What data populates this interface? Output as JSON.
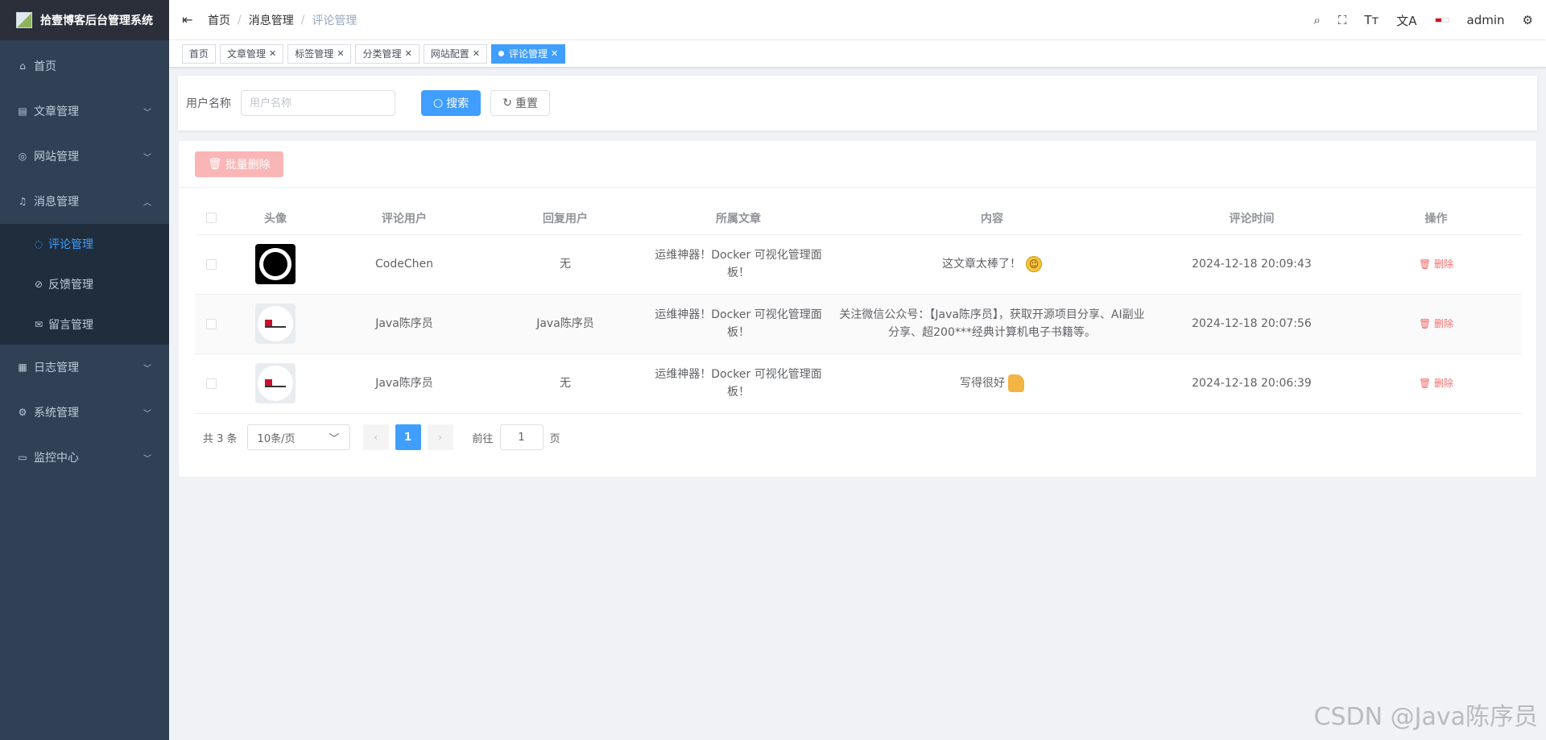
{
  "app": {
    "title": "拾壹博客后台管理系统"
  },
  "sidebar": {
    "items": [
      {
        "label": "首页",
        "icon": "home-icon"
      },
      {
        "label": "文章管理",
        "icon": "document-icon"
      },
      {
        "label": "网站管理",
        "icon": "website-icon"
      },
      {
        "label": "消息管理",
        "icon": "bell-icon"
      },
      {
        "label": "日志管理",
        "icon": "log-icon"
      },
      {
        "label": "系统管理",
        "icon": "gear-icon"
      },
      {
        "label": "监控中心",
        "icon": "monitor-icon"
      }
    ],
    "message_sub": [
      {
        "label": "评论管理",
        "active": true
      },
      {
        "label": "反馈管理"
      },
      {
        "label": "留言管理"
      }
    ]
  },
  "breadcrumb": [
    "首页",
    "消息管理",
    "评论管理"
  ],
  "header": {
    "user": "admin"
  },
  "tags": [
    {
      "label": "首页"
    },
    {
      "label": "文章管理"
    },
    {
      "label": "标签管理"
    },
    {
      "label": "分类管理"
    },
    {
      "label": "网站配置"
    },
    {
      "label": "评论管理",
      "active": true
    }
  ],
  "search": {
    "label": "用户名称",
    "placeholder": "用户名称",
    "search_btn": "搜索",
    "reset_btn": "重置"
  },
  "toolbar": {
    "batch_delete": "批量删除"
  },
  "table": {
    "columns": [
      "头像",
      "评论用户",
      "回复用户",
      "所属文章",
      "内容",
      "评论时间",
      "操作"
    ],
    "rows": [
      {
        "user": "CodeChen",
        "reply": "无",
        "article": "运维神器！Docker 可视化管理面板！",
        "content": "这文章太棒了！",
        "time": "2024-12-18 20:09:43",
        "action": "删除"
      },
      {
        "user": "Java陈序员",
        "reply": "Java陈序员",
        "article": "运维神器！Docker 可视化管理面板！",
        "content": "关注微信公众号：【Java陈序员】，获取开源项目分享、AI副业分享、超200***经典计算机电子书籍等。",
        "time": "2024-12-18 20:07:56",
        "action": "删除"
      },
      {
        "user": "Java陈序员",
        "reply": "无",
        "article": "运维神器！Docker 可视化管理面板！",
        "content": "写得很好",
        "time": "2024-12-18 20:06:39",
        "action": "删除"
      }
    ]
  },
  "pagination": {
    "total": "共 3 条",
    "page_size": "10条/页",
    "current": "1",
    "goto_label": "前往",
    "goto_value": "1",
    "page_label": "页"
  },
  "watermark": "CSDN @Java陈序员"
}
